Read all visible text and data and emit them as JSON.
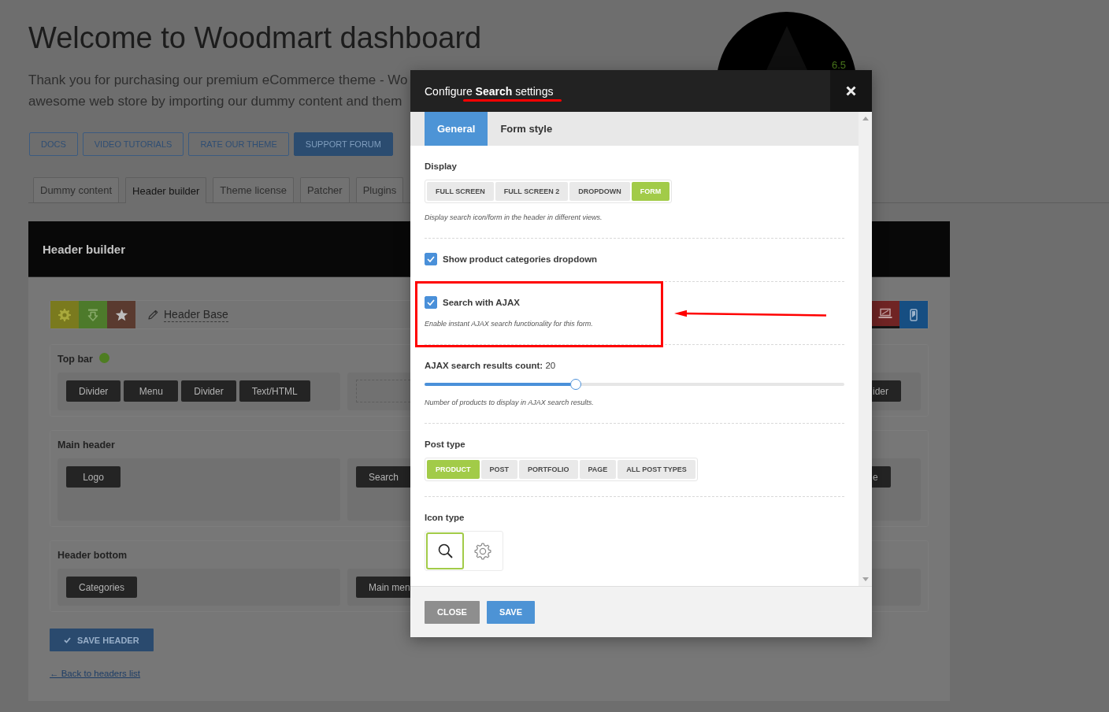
{
  "page": {
    "title": "Welcome to Woodmart dashboard",
    "intro_lines": [
      "Thank you for purchasing our premium eCommerce theme - Wo",
      "awesome web store by importing our dummy content and them"
    ],
    "link_buttons": [
      {
        "label": "DOCS",
        "kind": "outline"
      },
      {
        "label": "VIDEO TUTORIALS",
        "kind": "outline"
      },
      {
        "label": "RATE OUR THEME",
        "kind": "outline"
      },
      {
        "label": "SUPPORT FORUM",
        "kind": "filled"
      }
    ],
    "tabs": [
      {
        "label": "Dummy content",
        "selected": false
      },
      {
        "label": "Header builder",
        "selected": true
      },
      {
        "label": "Theme license",
        "selected": false
      },
      {
        "label": "Patcher",
        "selected": false
      },
      {
        "label": "Plugins",
        "selected": false
      }
    ],
    "gauge": {
      "reading": "6.5"
    }
  },
  "header_builder": {
    "title": "Header builder",
    "header_name": "Header Base",
    "sections": [
      {
        "title": "Top bar",
        "color": "#4e7d22",
        "left_area": [
          {
            "kind": "element",
            "label": "Divider"
          },
          {
            "kind": "element",
            "label": "Menu"
          },
          {
            "kind": "element",
            "label": "Divider"
          },
          {
            "kind": "element",
            "label": "Text/HTML"
          }
        ],
        "center_area": [
          {
            "kind": "placeholder"
          }
        ],
        "right_area": [
          {
            "kind": "element",
            "label": "ider"
          }
        ]
      },
      {
        "title": "Main header",
        "left_area": [
          {
            "kind": "element",
            "label": "Logo"
          }
        ],
        "center_area": [
          {
            "kind": "element",
            "label": "Search"
          }
        ],
        "right_area": [
          {
            "kind": "element",
            "label": "e"
          }
        ]
      },
      {
        "title": "Header bottom",
        "left_area": [
          {
            "kind": "element",
            "label": "Categories"
          }
        ],
        "center_area": [
          {
            "kind": "element",
            "label": "Main men"
          }
        ]
      }
    ],
    "save_button": "SAVE HEADER",
    "back_link": "← Back to headers list"
  },
  "modal": {
    "title": "Configure **Search** settings",
    "title_underlined": true,
    "tabs": [
      {
        "label": "General",
        "selected": true
      },
      {
        "label": "Form style",
        "selected": false
      }
    ],
    "fields": [
      {
        "kind": "choice",
        "label": "Display",
        "options": [
          {
            "label": "FULL SCREEN",
            "selected": false
          },
          {
            "label": "FULL SCREEN 2",
            "selected": false
          },
          {
            "label": "DROPDOWN",
            "selected": false
          },
          {
            "label": "FORM",
            "selected": true
          }
        ],
        "description": "Display search icon/form in the header in different views."
      },
      {
        "kind": "checkbox",
        "label": "Show product categories dropdown",
        "checked": true
      },
      {
        "kind": "checkbox",
        "label": "Search with AJAX",
        "checked": true,
        "highlighted": true,
        "description": "Enable instant AJAX search functionality for this form."
      },
      {
        "kind": "slider",
        "label": "AJAX search results count:",
        "value": "20",
        "level": 0.36,
        "description": "Number of products to display in AJAX search results."
      },
      {
        "kind": "choice",
        "label": "Post type",
        "options": [
          {
            "label": "PRODUCT",
            "selected": true
          },
          {
            "label": "POST",
            "selected": false
          },
          {
            "label": "PORTFOLIO",
            "selected": false
          },
          {
            "label": "PAGE",
            "selected": false
          },
          {
            "label": "ALL POST TYPES",
            "selected": false
          }
        ]
      },
      {
        "kind": "icon_choice",
        "label": "Icon type",
        "options": [
          {
            "kind": "magnifier",
            "selected": true
          },
          {
            "kind": "gear",
            "selected": false
          }
        ]
      }
    ],
    "buttons": [
      {
        "label": "CLOSE",
        "kind": "secondary"
      },
      {
        "label": "SAVE",
        "kind": "primary"
      }
    ]
  }
}
